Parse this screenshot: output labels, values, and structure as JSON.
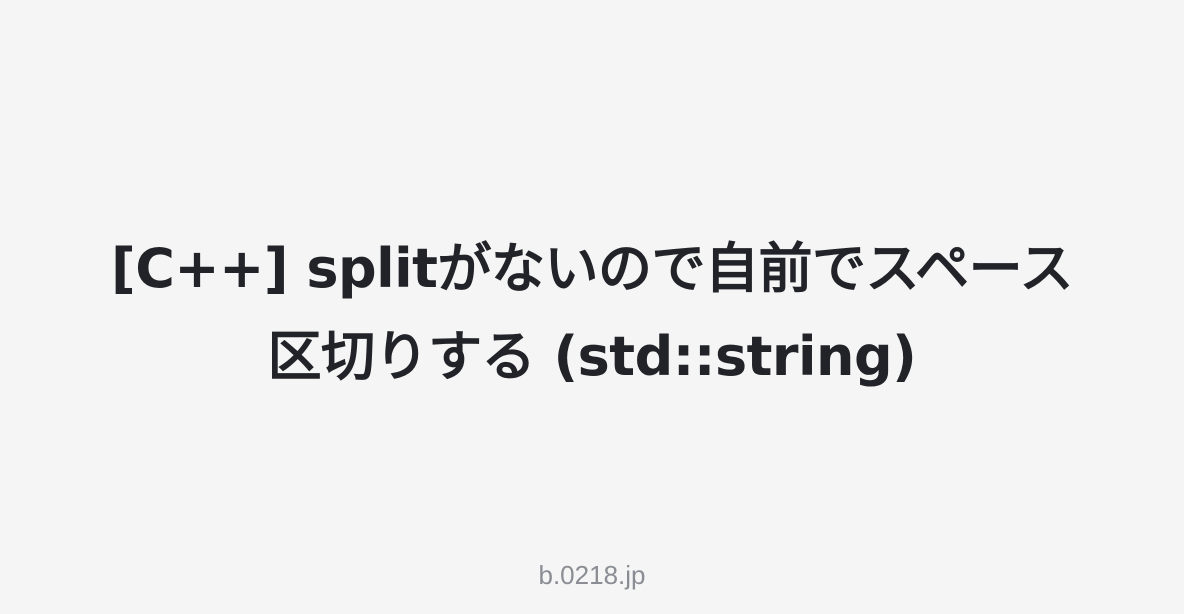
{
  "article": {
    "title": "[C++] splitがないので自前でスペース区切りする (std::string)"
  },
  "footer": {
    "site": "b.0218.jp"
  },
  "colors": {
    "background": "#f5f5f5",
    "title": "#222328",
    "site": "#8a8d93"
  }
}
